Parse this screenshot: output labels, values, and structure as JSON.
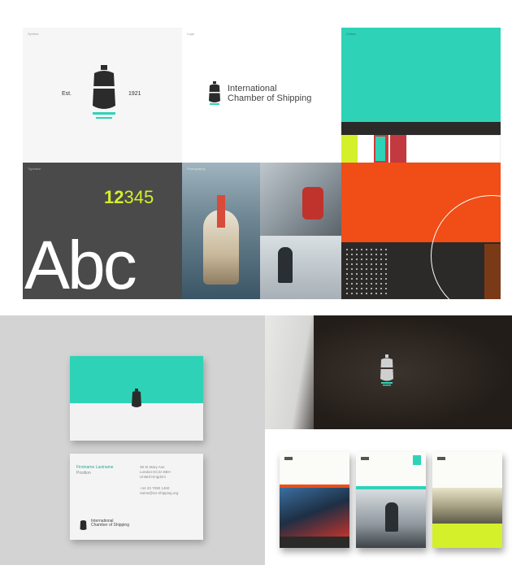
{
  "panels": {
    "icon_panel": {
      "tag": "Symbol",
      "left_label": "Est.",
      "right_label": "1921"
    },
    "wordmark_panel": {
      "tag": "Logo",
      "brand_line1": "International",
      "brand_line2": "Chamber of Shipping"
    },
    "color_panel": {
      "tag": "Colour"
    },
    "typography_panel": {
      "tag": "Typeface",
      "numerals_accent": "12",
      "numerals_rest": "345",
      "specimen": "Abc"
    },
    "photography_panel": {
      "tag": "Photography"
    }
  },
  "business_card": {
    "front_color": "#2ed3b7",
    "back_name_line1": "Firstname Lastname",
    "back_name_line2": "Position",
    "back_address_line1": "38 St Mary Axe",
    "back_address_line2": "London EC3A 8BH",
    "back_address_line3": "United Kingdom",
    "back_contact_line1": "+44 20 7090 1460",
    "back_contact_line2": "name@ics-shipping.org",
    "logo_line1": "International",
    "logo_line2": "Chamber of Shipping"
  },
  "colors": {
    "teal": "#2ed3b7",
    "dark": "#2b2a28",
    "lime": "#d4f02a",
    "red": "#d13a3a",
    "orange": "#f04d17",
    "charcoal": "#4a4a4a",
    "white": "#ffffff"
  },
  "icons": [
    "ship-icon",
    "ship-badge-icon"
  ]
}
